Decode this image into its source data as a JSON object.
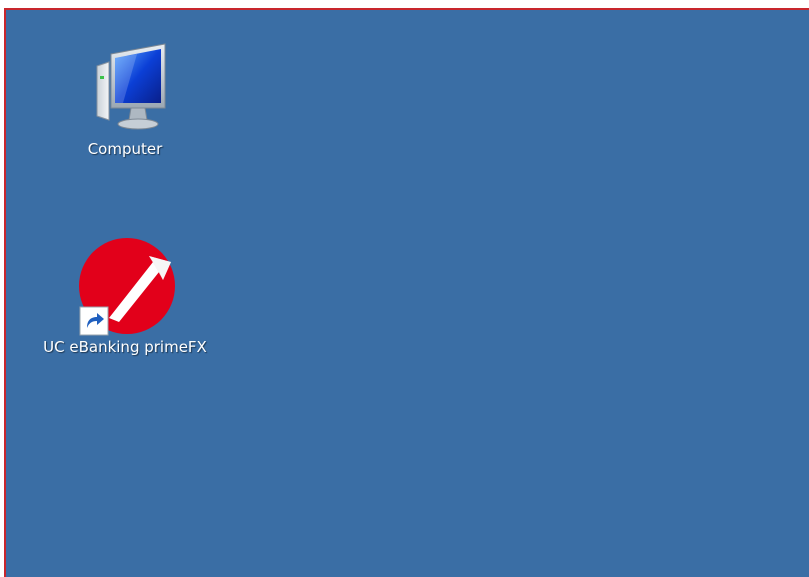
{
  "desktop": {
    "background_color": "#3a6ea5",
    "frame_border_color": "#c8262d",
    "icons": [
      {
        "label": "Computer",
        "icon": "computer-icon"
      },
      {
        "label": "UC eBanking primeFX",
        "icon": "unicredit-logo-icon",
        "shortcut": true,
        "shortcut_icon": "shortcut-arrow-icon"
      }
    ]
  }
}
